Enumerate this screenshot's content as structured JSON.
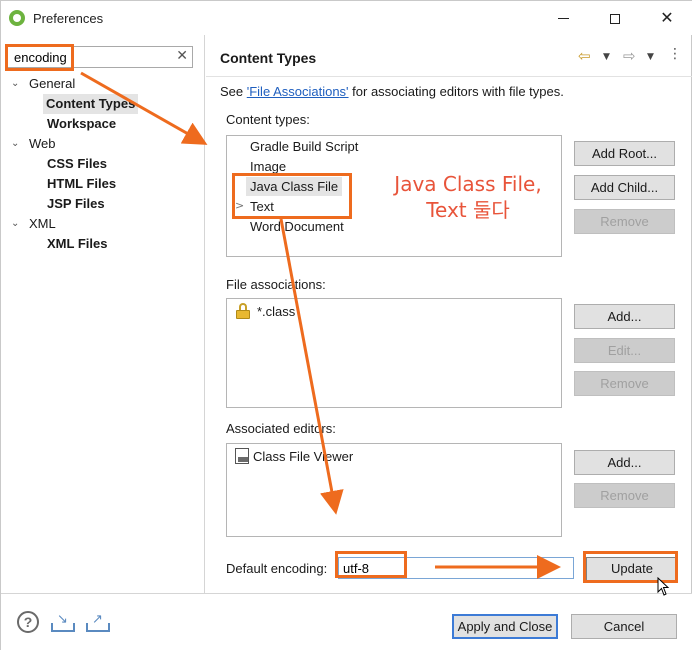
{
  "window": {
    "title": "Preferences",
    "icon": "spring-icon",
    "controls": {
      "minimize": "minimize-icon",
      "maximize": "maximize-icon",
      "close": "✕"
    }
  },
  "sidebar": {
    "filter": {
      "value": "encoding",
      "clear": "✕"
    },
    "tree": [
      {
        "label": "General",
        "arrow": "v"
      },
      {
        "label": "Content Types",
        "selected": true
      },
      {
        "label": "Workspace"
      },
      {
        "label": "Web",
        "arrow": "v"
      },
      {
        "label": "CSS Files"
      },
      {
        "label": "HTML Files"
      },
      {
        "label": "JSP Files"
      },
      {
        "label": "XML",
        "arrow": "v"
      },
      {
        "label": "XML Files"
      }
    ]
  },
  "main": {
    "title": "Content Types",
    "nav": {
      "back": "⇦",
      "forward": "⇨",
      "dropdown": "▼",
      "menu": "⋮"
    },
    "description": {
      "prefix": "See ",
      "link": "'File Associations'",
      "suffix": " for associating editors with file types."
    },
    "content_types": {
      "label": "Content types:",
      "items": [
        "Gradle Build Script",
        "Image",
        "Java Class File",
        "Text",
        "Word Document"
      ],
      "selected_index": 2,
      "text_expander": ">",
      "buttons": [
        {
          "label": "Add Root...",
          "enabled": true
        },
        {
          "label": "Add Child...",
          "enabled": true
        },
        {
          "label": "Remove",
          "enabled": false
        }
      ]
    },
    "file_associations": {
      "label": "File associations:",
      "items": [
        "*.class"
      ],
      "buttons": [
        {
          "label": "Add...",
          "enabled": true
        },
        {
          "label": "Edit...",
          "enabled": false
        },
        {
          "label": "Remove",
          "enabled": false
        }
      ]
    },
    "associated_editors": {
      "label": "Associated editors:",
      "items": [
        "Class File Viewer"
      ],
      "buttons": [
        {
          "label": "Add...",
          "enabled": true
        },
        {
          "label": "Remove",
          "enabled": false
        }
      ]
    },
    "default_encoding": {
      "label": "Default encoding:",
      "value": "utf-8",
      "button": "Update"
    }
  },
  "footer": {
    "help": "?",
    "import_icon": "import-icon",
    "export_icon": "export-icon",
    "apply_close": "Apply and Close",
    "cancel": "Cancel"
  },
  "annotation": {
    "note_line1": "Java Class File,",
    "note_line2": "Text 둘다",
    "color": "#ee6b1e"
  }
}
